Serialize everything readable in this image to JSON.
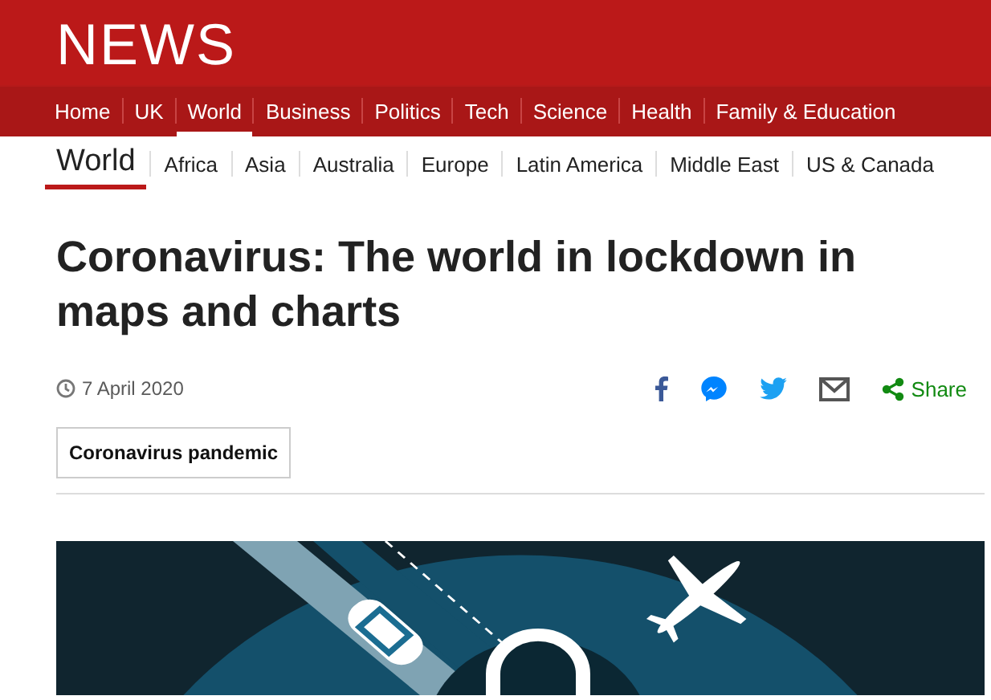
{
  "brand": {
    "logo": "NEWS"
  },
  "nav": [
    {
      "label": "Home",
      "selected": false
    },
    {
      "label": "UK",
      "selected": false
    },
    {
      "label": "World",
      "selected": true
    },
    {
      "label": "Business",
      "selected": false
    },
    {
      "label": "Politics",
      "selected": false
    },
    {
      "label": "Tech",
      "selected": false
    },
    {
      "label": "Science",
      "selected": false
    },
    {
      "label": "Health",
      "selected": false
    },
    {
      "label": "Family & Education",
      "selected": false
    }
  ],
  "subnav": {
    "title": "World",
    "items": [
      "Africa",
      "Asia",
      "Australia",
      "Europe",
      "Latin America",
      "Middle East",
      "US & Canada"
    ]
  },
  "article": {
    "headline": "Coronavirus: The world in lockdown in maps and charts",
    "date": "7 April 2020",
    "share_label": "Share",
    "tag": "Coronavirus pandemic"
  }
}
